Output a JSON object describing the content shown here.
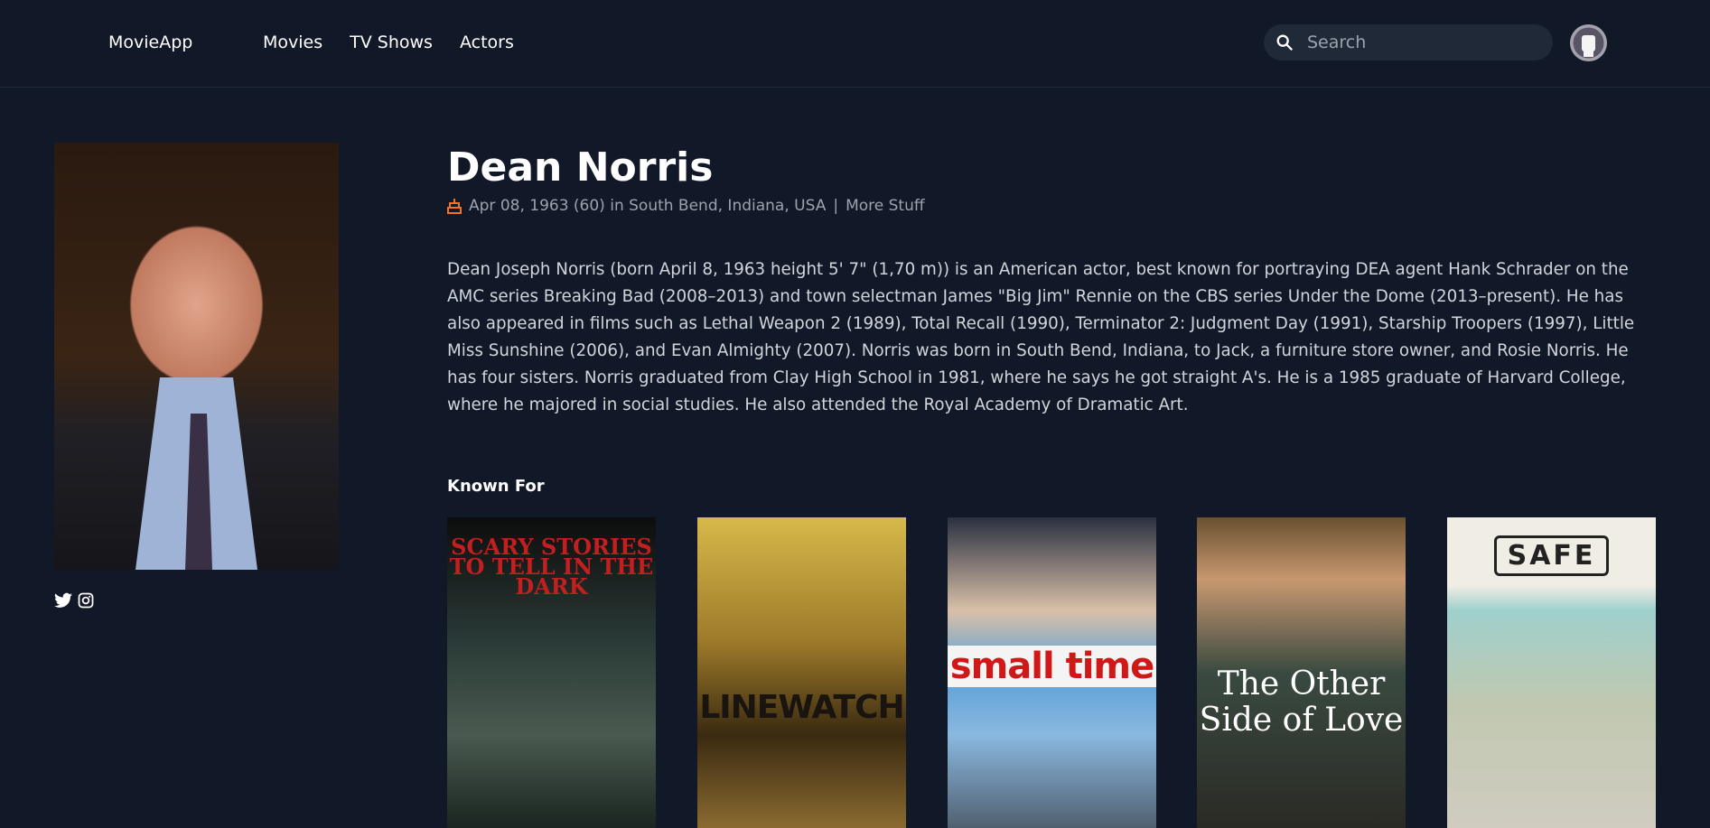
{
  "header": {
    "logo": "MovieApp",
    "nav": [
      {
        "label": "Movies"
      },
      {
        "label": "TV Shows"
      },
      {
        "label": "Actors"
      }
    ],
    "search_placeholder": "Search"
  },
  "actor": {
    "name": "Dean Norris",
    "birth_info": "Apr 08, 1963 (60) in South Bend, Indiana, USA",
    "separator": "|",
    "more_link": "More Stuff",
    "bio": "Dean Joseph Norris (born April 8, 1963 height 5' 7\" (1,70 m)) is an American actor, best known for portraying DEA agent Hank Schrader on the AMC series Breaking Bad (2008–2013) and town selectman James \"Big Jim\" Rennie on the CBS series Under the Dome (2013–present). He has also appeared in films such as Lethal Weapon 2 (1989), Total Recall (1990), Terminator 2: Judgment Day (1991), Starship Troopers (1997), Little Miss Sunshine (2006), and Evan Almighty (2007). Norris was born in South Bend, Indiana, to Jack, a furniture store owner, and Rosie Norris. He has four sisters. Norris graduated from Clay High School in 1981, where he says he got straight A's. He is a 1985 graduate of Harvard College, where he majored in social studies. He also attended the Royal Academy of Dramatic Art.",
    "social": [
      "twitter-icon",
      "instagram-icon"
    ]
  },
  "known_for": {
    "title": "Known For",
    "items": [
      {
        "title": "SCARY STORIES TO TELL IN THE DARK"
      },
      {
        "title": "LINEWATCH"
      },
      {
        "title": "small time"
      },
      {
        "title": "The Other Side of Love"
      },
      {
        "title": "SAFE"
      }
    ]
  },
  "colors": {
    "background": "#111827",
    "search_bg": "#1f2937",
    "birthday_icon": "#f97316",
    "muted_text": "#9ca3af"
  }
}
